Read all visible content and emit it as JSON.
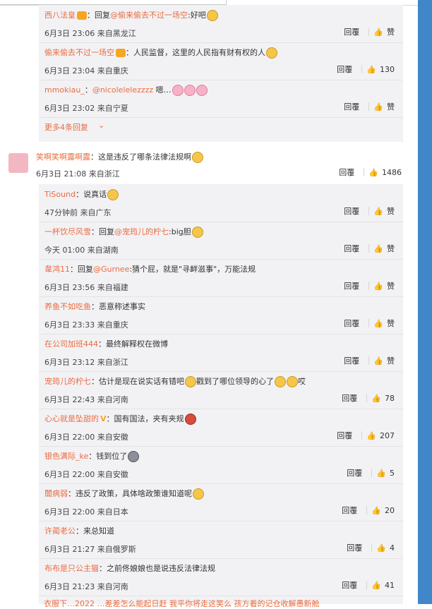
{
  "top_replies": [
    {
      "user": "西八法皇",
      "badge": true,
      "text_prefix": "：回复",
      "mention": "@偷来偷去不过一场空",
      "text": ":好吧",
      "emoji": "smile",
      "time": "6月3日 23:06 来自黑龙江",
      "reply_label": "回覆",
      "likes": "",
      "like_label": "赞"
    },
    {
      "user": "偷来偷去不过一场空",
      "badge": true,
      "text_prefix": "：",
      "mention": "",
      "text": "人民监督，这里的人民指有财有权的人",
      "emoji": "cat",
      "time": "6月3日 23:04 来自重庆",
      "reply_label": "回覆",
      "likes": "130",
      "like_label": ""
    },
    {
      "user": "mmokiau_",
      "badge": false,
      "text_prefix": "：",
      "mention": "@nicolelelezzzz",
      "text": " 嗯…",
      "emoji": "pig3",
      "time": "6月3日 23:02 来自宁夏",
      "reply_label": "回覆",
      "likes": "",
      "like_label": "赞"
    }
  ],
  "more_replies": "更多4条回复",
  "main_comment": {
    "user": "笑啊笑啊露啊露",
    "text": "：这是违反了哪条法律法规啊",
    "time": "6月3日 21:08 来自浙江",
    "reply_label": "回覆",
    "likes": "1486"
  },
  "replies": [
    {
      "user": "TiSound",
      "text": "：说真话",
      "mention": "",
      "emoji": "yes",
      "time": "47分钟前 来自广东",
      "reply_label": "回覆",
      "likes": "",
      "like_label": "赞"
    },
    {
      "user": "一杯饮尽风雪",
      "text_prefix": "：回复",
      "mention": "@宠筠儿的柠七",
      "text": ":big胆",
      "emoji": "cat",
      "time": "今天 01:00 来自湖南",
      "reply_label": "回覆",
      "likes": "",
      "like_label": "赞"
    },
    {
      "user": "韋鸿11",
      "text_prefix": "：回复",
      "mention": "@Gurnee",
      "text": ":猜个屁，就是\"寻衅滋事\"，万能法规",
      "emoji": "",
      "time": "6月3日 23:56 来自福建",
      "reply_label": "回覆",
      "likes": "",
      "like_label": "赞"
    },
    {
      "user": "养鱼不如吃鱼",
      "text": "：恶意称述事实",
      "mention": "",
      "emoji": "",
      "time": "6月3日 23:33 来自重庆",
      "reply_label": "回覆",
      "likes": "",
      "like_label": "赞"
    },
    {
      "user": "在公司加班444",
      "text": "：最终解释权在微博",
      "mention": "",
      "emoji": "",
      "time": "6月3日 23:12 来自浙江",
      "reply_label": "回覆",
      "likes": "",
      "like_label": "赞"
    },
    {
      "user": "宠筠儿的柠七",
      "text": "：估计是现在说实话有错吧",
      "mention": "",
      "emoji": "cat",
      "text2": "戳到了哪位领导的心了",
      "emoji2": "cat2",
      "text3": "哎",
      "time": "6月3日 22:43 来自河南",
      "reply_label": "回覆",
      "likes": "78",
      "like_label": ""
    },
    {
      "user": "心心就是坠甜的",
      "vbadge": "V",
      "text": "：国有国法，夹有夹规",
      "mention": "",
      "emoji": "red",
      "time": "6月3日 22:00 来自安徽",
      "reply_label": "回覆",
      "likes": "207",
      "like_label": ""
    },
    {
      "user": "银色满际_ke",
      "text": "：钱到位了",
      "mention": "",
      "emoji": "grey",
      "time": "6月3日 22:00 来自安徽",
      "reply_label": "回覆",
      "likes": "5",
      "like_label": ""
    },
    {
      "user": "闟病弱",
      "text": "：违反了政策，具体啥政策谁知道呢",
      "mention": "",
      "emoji": "cat",
      "time": "6月3日 22:00 来自日本",
      "reply_label": "回覆",
      "likes": "20",
      "like_label": ""
    },
    {
      "user": "许蔺老公",
      "text": "：来总知道",
      "mention": "",
      "emoji": "",
      "time": "6月3日 21:27 来自俄罗斯",
      "reply_label": "回覆",
      "likes": "4",
      "like_label": ""
    },
    {
      "user": "布布是只公主猫",
      "text": "：之前佟娘娘也是说违反法律法规",
      "mention": "",
      "emoji": "",
      "time": "6月3日 21:23 来自河南",
      "reply_label": "回覆",
      "likes": "41",
      "like_label": ""
    }
  ],
  "cut_off_text": "衣服下…2022 …差差怎么能起日赶 我平你将走这笑么 孩方着的记仓收解愚新舱"
}
